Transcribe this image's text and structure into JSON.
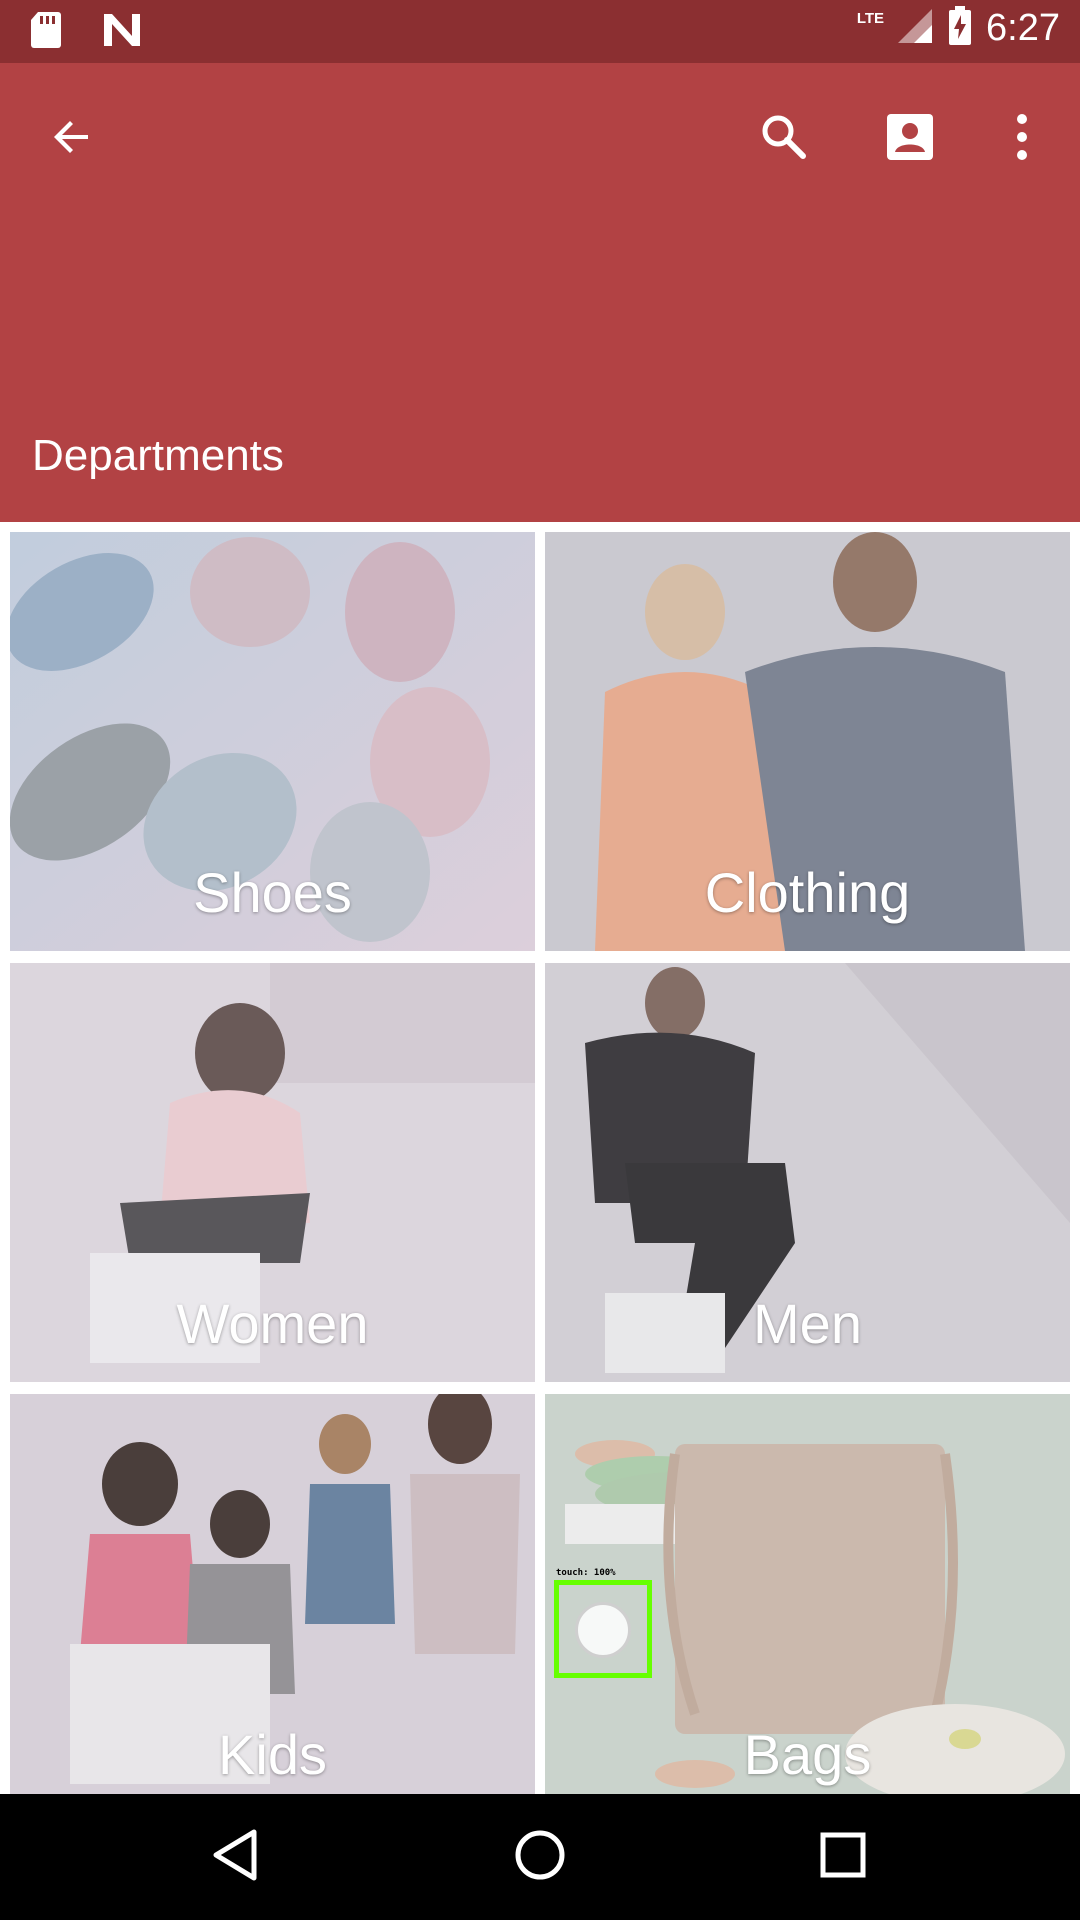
{
  "status_bar": {
    "time": "6:27",
    "network": "LTE",
    "icons": [
      "sd-card-icon",
      "n-notification-icon",
      "signal-icon",
      "battery-charging-icon"
    ]
  },
  "app_bar": {
    "title": "Departments",
    "actions": [
      "back-arrow-icon",
      "search-icon",
      "account-box-icon",
      "more-vert-icon"
    ],
    "color": "#b24244"
  },
  "departments": [
    {
      "label": "Shoes"
    },
    {
      "label": "Clothing"
    },
    {
      "label": "Women"
    },
    {
      "label": "Men"
    },
    {
      "label": "Kids"
    },
    {
      "label": "Bags"
    }
  ],
  "touch_overlay": {
    "label": "touch: 100%"
  },
  "nav_bar": {
    "buttons": [
      "back-triangle-icon",
      "home-circle-icon",
      "recents-square-icon"
    ]
  }
}
